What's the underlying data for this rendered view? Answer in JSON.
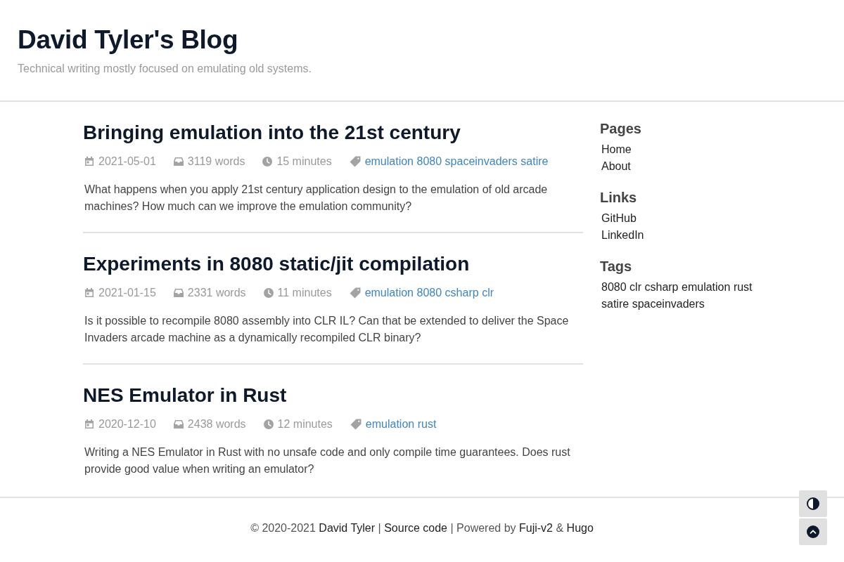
{
  "header": {
    "title": "David Tyler's Blog",
    "subtitle": "Technical writing mostly focused on emulating old systems."
  },
  "posts": [
    {
      "title": "Bringing emulation into the 21st century",
      "date": "2021-05-01",
      "words": "3119 words",
      "reading_time": "15 minutes",
      "tags": [
        "emulation",
        "8080",
        "spaceinvaders",
        "satire"
      ],
      "summary": "What happens when you apply 21st century application design to the emulation of old arcade machines? How much can we improve the emulation community?"
    },
    {
      "title": "Experiments in 8080 static/jit compilation",
      "date": "2021-01-15",
      "words": "2331 words",
      "reading_time": "11 minutes",
      "tags": [
        "emulation",
        "8080",
        "csharp",
        "clr"
      ],
      "summary": "Is it possible to recompile 8080 assembly into CLR IL? Can that be extended to deliver the Space Invaders arcade machine as a dynamically recompiled CLR binary?"
    },
    {
      "title": "NES Emulator in Rust",
      "date": "2020-12-10",
      "words": "2438 words",
      "reading_time": "12 minutes",
      "tags": [
        "emulation",
        "rust"
      ],
      "summary": "Writing a NES Emulator in Rust with no unsafe code and only compile time guarantees. Does rust provide good value when writing an emulator?"
    }
  ],
  "sidebar": {
    "sections": [
      {
        "heading": "Pages",
        "kind": "list",
        "items": [
          "Home",
          "About"
        ]
      },
      {
        "heading": "Links",
        "kind": "list",
        "items": [
          "GitHub",
          "LinkedIn"
        ]
      },
      {
        "heading": "Tags",
        "kind": "inline",
        "items": [
          "8080",
          "clr",
          "csharp",
          "emulation",
          "rust",
          "satire",
          "spaceinvaders"
        ]
      }
    ]
  },
  "footer": {
    "parts": [
      {
        "kind": "text",
        "text": "© 2020-2021"
      },
      {
        "kind": "link",
        "text": "David Tyler"
      },
      {
        "kind": "text",
        "text": "|"
      },
      {
        "kind": "link",
        "text": "Source code"
      },
      {
        "kind": "text",
        "text": "| Powered by"
      },
      {
        "kind": "link",
        "text": "Fuji-v2"
      },
      {
        "kind": "text",
        "text": "&"
      },
      {
        "kind": "link",
        "text": "Hugo"
      }
    ]
  },
  "floating_buttons": [
    {
      "kind": "theme"
    },
    {
      "kind": "top"
    }
  ]
}
